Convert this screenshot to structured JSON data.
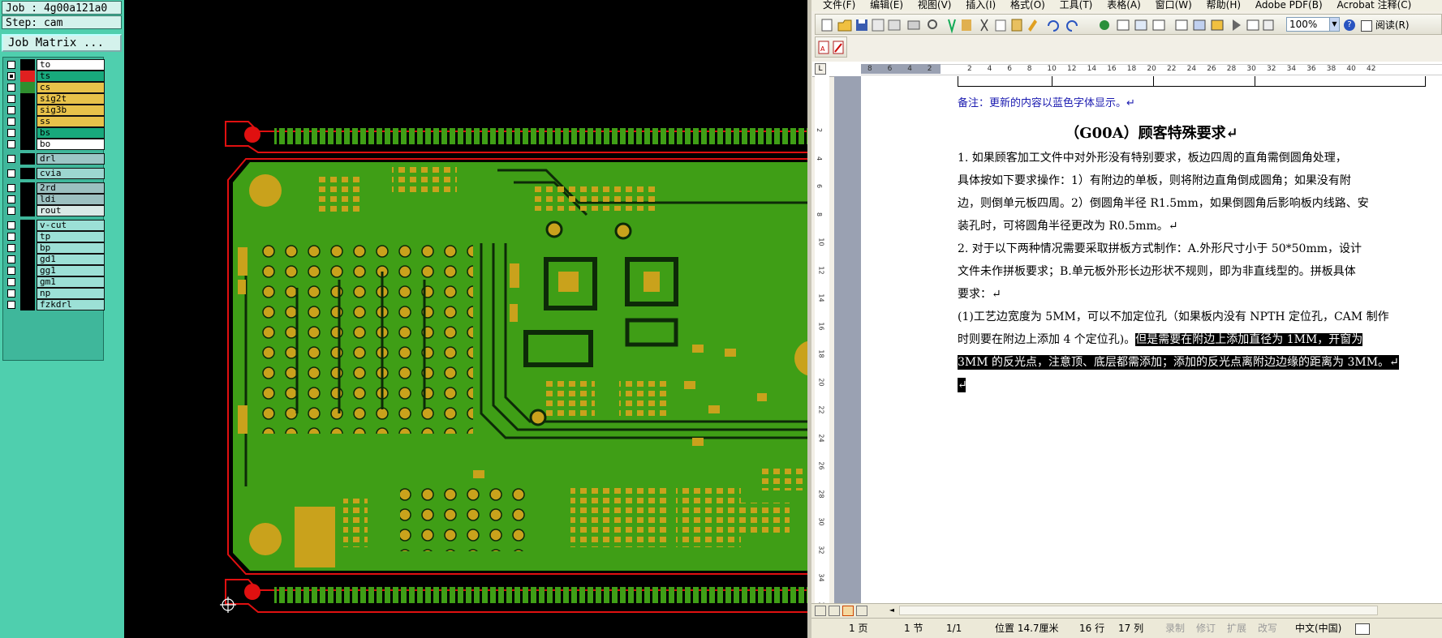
{
  "cam": {
    "job_line": "Job : 4g00a121a0",
    "step_line": "Step: cam",
    "job_matrix_label": "Job Matrix ...",
    "layers": [
      {
        "name": "to",
        "color": "#ffffff",
        "checked": false,
        "swatch": "#000000"
      },
      {
        "name": "ts",
        "color": "#18a97c",
        "checked": true,
        "swatch": "#e02020"
      },
      {
        "name": "cs",
        "color": "#e8c24a",
        "checked": false,
        "swatch": "#2f8f2f"
      },
      {
        "name": "sig2t",
        "color": "#e8c24a",
        "checked": false,
        "swatch": "#000000"
      },
      {
        "name": "sig3b",
        "color": "#e8c24a",
        "checked": false,
        "swatch": "#000000"
      },
      {
        "name": "ss",
        "color": "#e8c24a",
        "checked": false,
        "swatch": "#000000"
      },
      {
        "name": "bs",
        "color": "#18a97c",
        "checked": false,
        "swatch": "#000000"
      },
      {
        "name": "bo",
        "color": "#ffffff",
        "checked": false,
        "swatch": "#000000"
      },
      {
        "name": "drl",
        "color": "#9cc6c6",
        "checked": false,
        "swatch": "#000000"
      },
      {
        "name": "cvia",
        "color": "#9cd6d0",
        "checked": false,
        "swatch": "#000000"
      },
      {
        "name": "2rd",
        "color": "#9cc0c0",
        "checked": false,
        "swatch": "#000000"
      },
      {
        "name": "ldi",
        "color": "#9cc0c0",
        "checked": false,
        "swatch": "#000000"
      },
      {
        "name": "rout",
        "color": "#d9e9e6",
        "checked": false,
        "swatch": "#000000"
      },
      {
        "name": "v-cut",
        "color": "#9ce0d6",
        "checked": false,
        "swatch": "#000000"
      },
      {
        "name": "tp",
        "color": "#9ce0d6",
        "checked": false,
        "swatch": "#000000"
      },
      {
        "name": "bp",
        "color": "#9ce0d6",
        "checked": false,
        "swatch": "#000000"
      },
      {
        "name": "gd1",
        "color": "#9ce0d6",
        "checked": false,
        "swatch": "#000000"
      },
      {
        "name": "gg1",
        "color": "#9ce0d6",
        "checked": false,
        "swatch": "#000000"
      },
      {
        "name": "gm1",
        "color": "#9ce0d6",
        "checked": false,
        "swatch": "#000000"
      },
      {
        "name": "np",
        "color": "#9ce0d6",
        "checked": false,
        "swatch": "#000000"
      },
      {
        "name": "fzkdrl",
        "color": "#9ce0d6",
        "checked": false,
        "swatch": "#000000"
      }
    ]
  },
  "word": {
    "menus": [
      "文件(F)",
      "编辑(E)",
      "视图(V)",
      "插入(I)",
      "格式(O)",
      "工具(T)",
      "表格(A)",
      "窗口(W)",
      "帮助(H)",
      "Adobe PDF(B)",
      "Acrobat 注释(C)"
    ],
    "zoom": "100%",
    "read_mode": "阅读(R)",
    "ruler_numbers": [
      "8",
      "6",
      "4",
      "2",
      "",
      "2",
      "4",
      "6",
      "8",
      "10",
      "12",
      "14",
      "16",
      "18",
      "20",
      "22",
      "24",
      "26",
      "28",
      "30",
      "32",
      "34",
      "36",
      "38",
      "40",
      "42"
    ],
    "vruler_numbers": [
      "2",
      "4",
      "6",
      "8",
      "10",
      "12",
      "14",
      "16",
      "18",
      "20",
      "22",
      "24",
      "26",
      "28",
      "30",
      "32",
      "34",
      "36"
    ],
    "note": "备注：更新的内容以蓝色字体显示。↵",
    "title": "（G00A）顾客特殊要求↵",
    "lines": [
      "1. 如果顾客加工文件中对外形没有特别要求，板边四周的直角需倒圆角处理，",
      "具体按如下要求操作：1）有附边的单板，则将附边直角倒成圆角；如果没有附",
      "边，则倒单元板四周。2）倒圆角半径 R1.5mm，如果倒圆角后影响板内线路、安",
      "装孔时，可将圆角半径更改为 R0.5mm。↵",
      "2. 对于以下两种情况需要采取拼板方式制作：A.外形尺寸小于 50*50mm，设计",
      "文件未作拼板要求；B.单元板外形长边形状不规则，即为非直线型的。拼板具体",
      "要求：↵"
    ],
    "line8_normal": "(1)工艺边宽度为 5MM，可以不加定位孔（如果板内没有 NPTH 定位孔，CAM 制作",
    "line9_normal": "时则要在附边上添加 4 个定位孔)。",
    "line9_highlight": "但是需要在附边上添加直径为 1MM，开窗为",
    "line10_highlight": "3MM 的反光点，注意顶、底层都需添加；添加的反光点离附边边缘的距离为 3MM。↵",
    "line11_highlight": "↵",
    "status": {
      "page": "1 页",
      "section": "1 节",
      "pages": "1/1",
      "position": "位置 14.7厘米",
      "line": "16 行",
      "col": "17 列",
      "rec": "录制",
      "trk": "修订",
      "ext": "扩展",
      "ovr": "改写",
      "lang": "中文(中国)"
    }
  },
  "colors": {
    "board_green": "#3f9e16",
    "pad_gold": "#c9a21c",
    "outline_red": "#e01010",
    "trace_dark": "#0d2a08"
  }
}
